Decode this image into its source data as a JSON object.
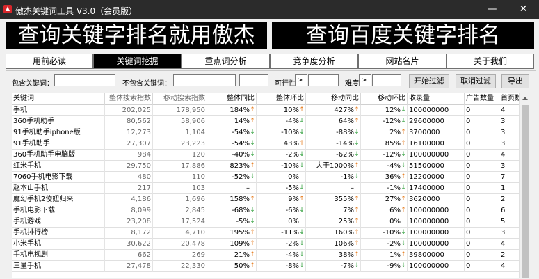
{
  "window": {
    "title": "傲杰关键词工具 V3.0（会员版）",
    "minimize_glyph": "—",
    "maximize_glyph": "☐",
    "close_glyph": "✕"
  },
  "banner": {
    "left": "查询关键字排名就用傲杰",
    "right": "查询百度关键字排名"
  },
  "tabs": [
    "用前必读",
    "关键词挖掘",
    "重点词分析",
    "竞争度分析",
    "网站名片",
    "关于我们"
  ],
  "active_tab": 1,
  "filters": {
    "include_label": "包含关键词：",
    "exclude_label": "不包含关键词：",
    "feasibility_label": "可行性",
    "feasibility_op": ">",
    "difficulty_label": "难度",
    "difficulty_op": ">",
    "start_button": "开始过滤",
    "cancel_button": "取消过滤",
    "export_button": "导出"
  },
  "table": {
    "headers": [
      "关键词",
      "整体搜索指数",
      "移动搜索指数",
      "整体同比",
      "整体环比",
      "移动同比",
      "移动环比",
      "收录量",
      "广告数量",
      "首页数量"
    ],
    "rows": [
      {
        "kw": "手机",
        "tot": "202,025",
        "mob": "178,950",
        "ty": "184%",
        "tya": "up",
        "th": "10%",
        "tha": "up",
        "mty": "427%",
        "mtya": "up",
        "mth": "12%",
        "mtha": "down",
        "vol": "100000000",
        "ad": "0",
        "pg": "4"
      },
      {
        "kw": "360手机助手",
        "tot": "80,562",
        "mob": "58,906",
        "ty": "14%",
        "tya": "up",
        "th": "-4%",
        "tha": "down",
        "mty": "64%",
        "mtya": "up",
        "mth": "-12%",
        "mtha": "down",
        "vol": "29600000",
        "ad": "0",
        "pg": "3"
      },
      {
        "kw": "91手机助手iphone版",
        "tot": "12,273",
        "mob": "1,104",
        "ty": "-54%",
        "tya": "down",
        "th": "-10%",
        "tha": "down",
        "mty": "-88%",
        "mtya": "down",
        "mth": "2%",
        "mtha": "up",
        "vol": "3700000",
        "ad": "0",
        "pg": "3"
      },
      {
        "kw": "91手机助手",
        "tot": "27,307",
        "mob": "23,223",
        "ty": "-54%",
        "tya": "down",
        "th": "43%",
        "tha": "up",
        "mty": "-14%",
        "mtya": "down",
        "mth": "85%",
        "mtha": "up",
        "vol": "16100000",
        "ad": "0",
        "pg": "3"
      },
      {
        "kw": "360手机助手电脑版",
        "tot": "984",
        "mob": "120",
        "ty": "-40%",
        "tya": "down",
        "th": "-2%",
        "tha": "down",
        "mty": "-62%",
        "mtya": "down",
        "mth": "-12%",
        "mtha": "down",
        "vol": "100000000",
        "ad": "0",
        "pg": "4"
      },
      {
        "kw": "红米手机",
        "tot": "29,750",
        "mob": "17,886",
        "ty": "823%",
        "tya": "up",
        "th": "-10%",
        "tha": "down",
        "mty": "大于1000%",
        "mtya": "up",
        "mth": "-4%",
        "mtha": "down",
        "vol": "51500000",
        "ad": "0",
        "pg": "3"
      },
      {
        "kw": "7060手机电影下载",
        "tot": "480",
        "mob": "110",
        "ty": "-52%",
        "tya": "down",
        "th": "0%",
        "tha": "",
        "mty": "-1%",
        "mtya": "down",
        "mth": "36%",
        "mtha": "up",
        "vol": "12200000",
        "ad": "0",
        "pg": "7"
      },
      {
        "kw": "赵本山手机",
        "tot": "217",
        "mob": "103",
        "ty": "–",
        "tya": "",
        "th": "-5%",
        "tha": "down",
        "mty": "–",
        "mtya": "",
        "mth": "-1%",
        "mtha": "down",
        "vol": "17400000",
        "ad": "0",
        "pg": "1"
      },
      {
        "kw": "魔幻手机2傻妞归来",
        "tot": "4,186",
        "mob": "1,696",
        "ty": "158%",
        "tya": "up",
        "th": "9%",
        "tha": "up",
        "mty": "355%",
        "mtya": "up",
        "mth": "27%",
        "mtha": "up",
        "vol": "3620000",
        "ad": "0",
        "pg": "2"
      },
      {
        "kw": "手机电影下载",
        "tot": "8,099",
        "mob": "2,845",
        "ty": "-68%",
        "tya": "down",
        "th": "-6%",
        "tha": "down",
        "mty": "7%",
        "mtya": "up",
        "mth": "6%",
        "mtha": "up",
        "vol": "100000000",
        "ad": "0",
        "pg": "6"
      },
      {
        "kw": "手机游戏",
        "tot": "23,208",
        "mob": "17,524",
        "ty": "-5%",
        "tya": "down",
        "th": "0%",
        "tha": "",
        "mty": "25%",
        "mtya": "up",
        "mth": "0%",
        "mtha": "",
        "vol": "100000000",
        "ad": "0",
        "pg": "5"
      },
      {
        "kw": "手机排行榜",
        "tot": "8,172",
        "mob": "4,710",
        "ty": "195%",
        "tya": "up",
        "th": "-11%",
        "tha": "down",
        "mty": "160%",
        "mtya": "up",
        "mth": "-10%",
        "mtha": "down",
        "vol": "100000000",
        "ad": "0",
        "pg": "3"
      },
      {
        "kw": "小米手机",
        "tot": "30,622",
        "mob": "20,478",
        "ty": "109%",
        "tya": "up",
        "th": "-2%",
        "tha": "down",
        "mty": "106%",
        "mtya": "up",
        "mth": "-2%",
        "mtha": "down",
        "vol": "100000000",
        "ad": "0",
        "pg": "4"
      },
      {
        "kw": "手机电视剧",
        "tot": "662",
        "mob": "269",
        "ty": "21%",
        "tya": "up",
        "th": "-4%",
        "tha": "down",
        "mty": "38%",
        "mtya": "up",
        "mth": "1%",
        "mtha": "up",
        "vol": "39800000",
        "ad": "0",
        "pg": "2"
      },
      {
        "kw": "三星手机",
        "tot": "27,478",
        "mob": "22,330",
        "ty": "50%",
        "tya": "up",
        "th": "-8%",
        "tha": "down",
        "mty": "-7%",
        "mtya": "down",
        "mth": "-9%",
        "mtha": "down",
        "vol": "100000000",
        "ad": "0",
        "pg": "4"
      }
    ]
  },
  "colors": {
    "up_arrow": "#e67e22",
    "down_arrow": "#2e9e3a",
    "banner_bg": "#000000"
  }
}
